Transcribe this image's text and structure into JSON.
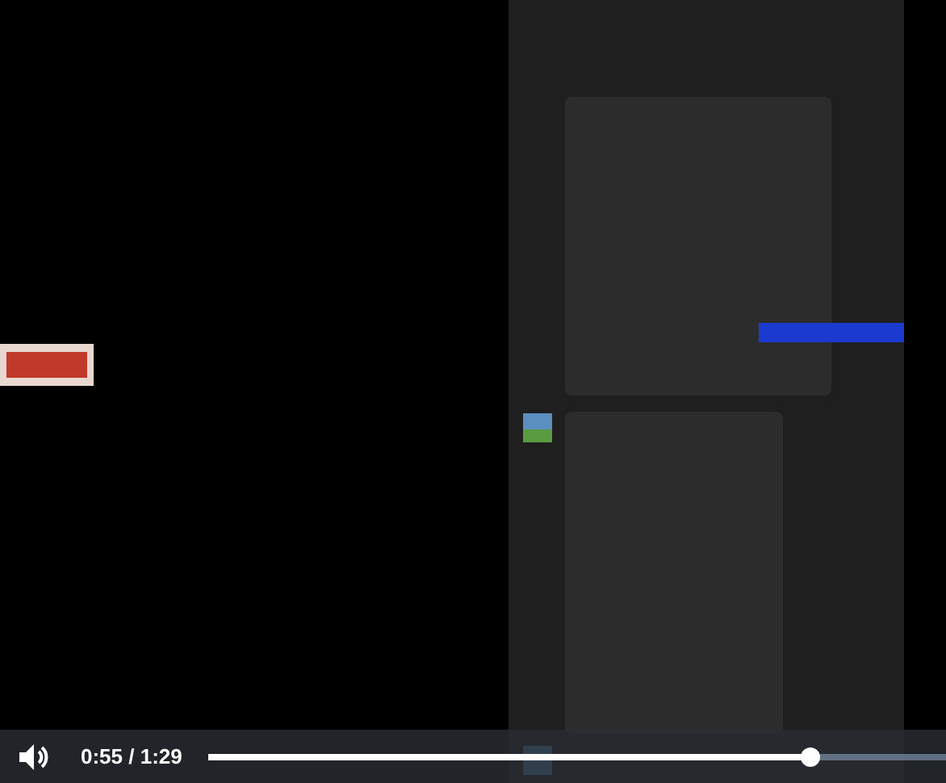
{
  "controls": {
    "muted": false,
    "time": "0:55 / 1:29",
    "progress": {
      "level": 0.817
    }
  }
}
